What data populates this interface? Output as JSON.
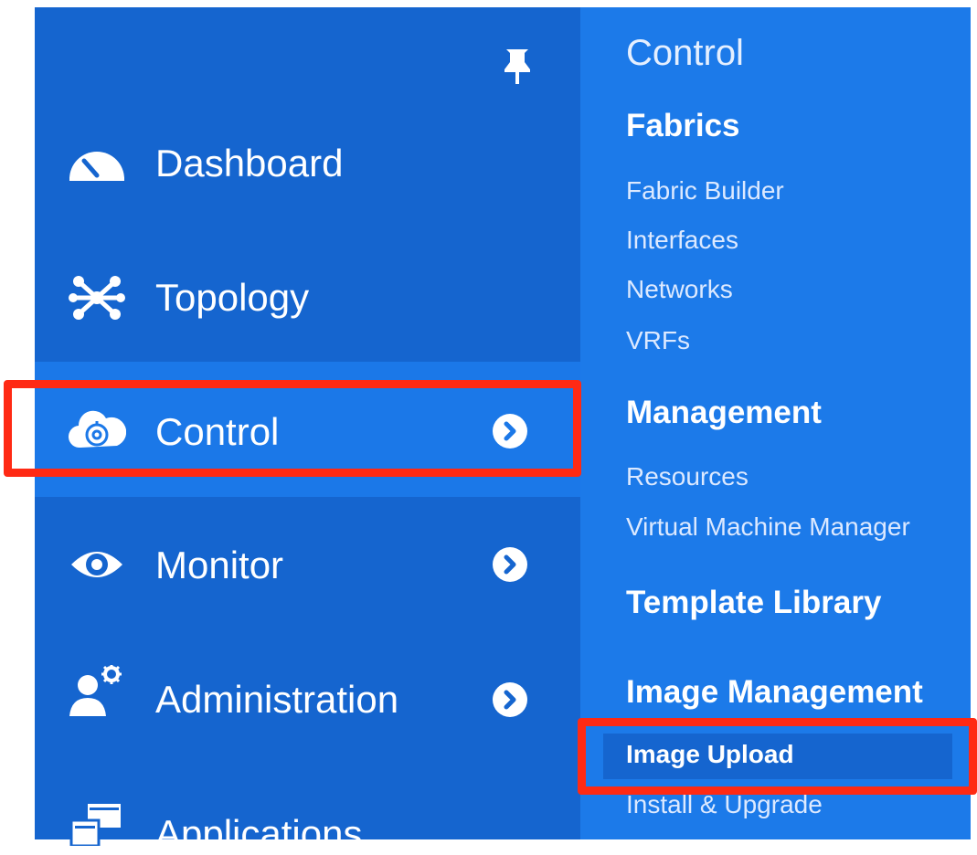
{
  "sidebar": {
    "pin_icon": "pin-icon",
    "items": [
      {
        "id": "dashboard",
        "label": "Dashboard",
        "icon": "gauge-icon",
        "has_submenu": false
      },
      {
        "id": "topology",
        "label": "Topology",
        "icon": "topology-icon",
        "has_submenu": false
      },
      {
        "id": "control",
        "label": "Control",
        "icon": "cloud-gear-icon",
        "has_submenu": true,
        "active": true
      },
      {
        "id": "monitor",
        "label": "Monitor",
        "icon": "eye-icon",
        "has_submenu": true
      },
      {
        "id": "administration",
        "label": "Administration",
        "icon": "admin-user-gear-icon",
        "has_submenu": true
      },
      {
        "id": "applications",
        "label": "Applications",
        "icon": "applications-icon",
        "has_submenu": false
      }
    ]
  },
  "flyout": {
    "title": "Control",
    "sections": [
      {
        "heading": "Fabrics",
        "links": [
          "Fabric Builder",
          "Interfaces",
          "Networks",
          "VRFs"
        ]
      },
      {
        "heading": "Management",
        "links": [
          "Resources",
          "Virtual Machine Manager"
        ]
      },
      {
        "heading": "Template Library",
        "links": []
      },
      {
        "heading": "Image Management",
        "links": [
          "Image Upload",
          "Install & Upgrade"
        ],
        "selected": "Image Upload"
      }
    ]
  },
  "colors": {
    "sidebar_bg": "#1565cf",
    "active_item_bg": "#1b78e8",
    "flyout_bg": "#1c7ae9",
    "highlight": "#ff2a14"
  }
}
